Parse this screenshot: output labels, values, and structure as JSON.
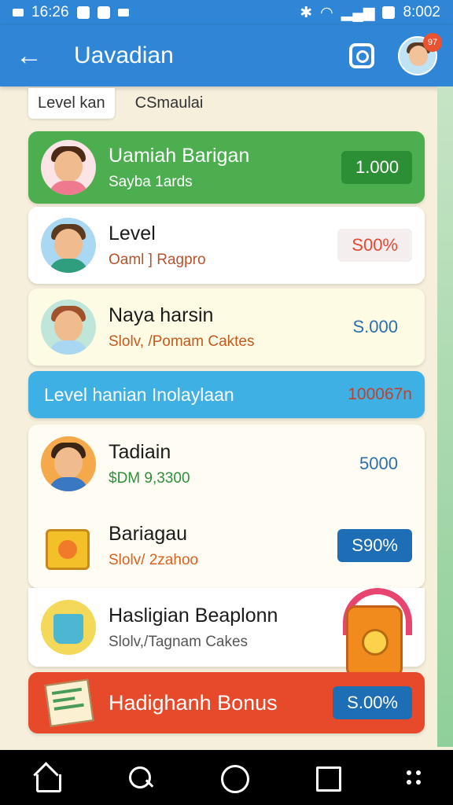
{
  "statusbar": {
    "time_left": "16:26",
    "time_right": "8:002"
  },
  "header": {
    "title": "Uavadian",
    "badge": "97"
  },
  "tabs": [
    {
      "label": "Level kan"
    },
    {
      "label": "CSmaulai"
    }
  ],
  "cards": [
    {
      "title": "Uamiah Barigan",
      "subtitle": "Sayba 1ards",
      "value": "1.000"
    },
    {
      "title": "Level",
      "subtitle": "Oaml ] Ragpro",
      "value": "S00%"
    },
    {
      "title": "Naya harsin",
      "subtitle": "Slolv, /Pomam Caktes",
      "value": "S.000"
    }
  ],
  "banner": {
    "title": "Level hanian Inolaylaan",
    "value": "100067n"
  },
  "group": [
    {
      "title": "Tadiain",
      "subtitle": "$DM 9,3300",
      "value": "5000"
    },
    {
      "title": "Bariagau",
      "subtitle": "Slolv/ 2zahoo",
      "value": "S90%"
    }
  ],
  "card_halsigian": {
    "title": "Hasligian Beaplonn",
    "subtitle": "Slolv,/Tagnam Cakes"
  },
  "bonus": {
    "title": "Hadighanh Bonus",
    "value": "S.00%"
  },
  "colors": {
    "primary": "#2f86d6",
    "green": "#4cae4f",
    "red": "#e64a2b",
    "banner_blue": "#3fb0e4"
  }
}
